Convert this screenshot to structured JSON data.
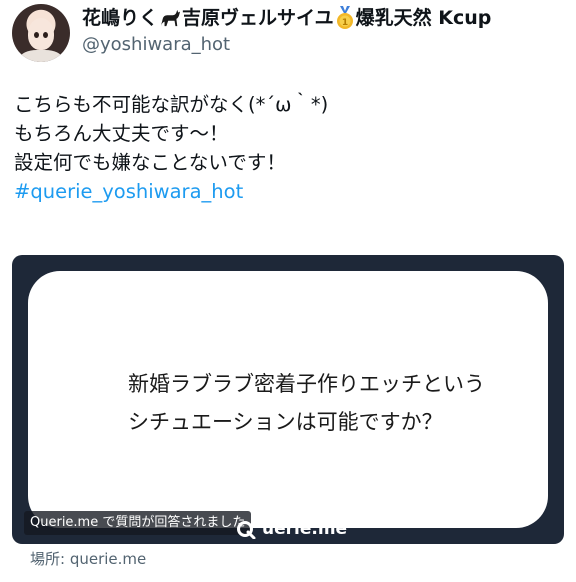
{
  "user": {
    "display_name_part1": "花嶋りく",
    "display_name_part2": "吉原ヴェルサイユ",
    "display_name_part3": "爆乳天然 Kcup",
    "handle": "@yoshiwara_hot",
    "icons": [
      "cat-icon",
      "medal-icon"
    ]
  },
  "tweet": {
    "lines": [
      "こちらも不可能な訳がなく(*´ω｀*)",
      "もちろん大丈夫です〜！",
      "設定何でも嫌なことないです！"
    ],
    "hashtag": "#querie_yoshiwara_hot"
  },
  "card": {
    "question_lines": [
      "新婚ラブラブ密着子作りエッチという",
      "シチュエーションは可能ですか？"
    ],
    "badge_text": "Querie.me で質問が回答されました",
    "brand_text": "uerie.me",
    "bg_color": "#1e2838"
  },
  "location": {
    "label": "場所: querie.me"
  }
}
